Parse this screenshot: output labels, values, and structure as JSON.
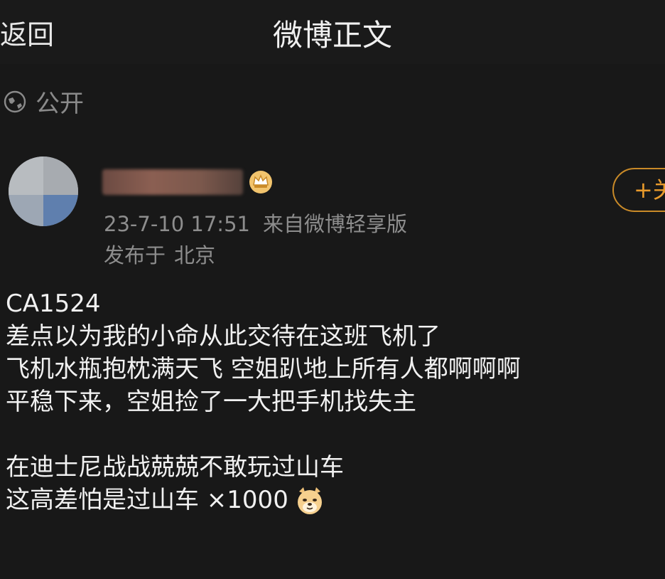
{
  "header": {
    "back_label": "返回",
    "title": "微博正文"
  },
  "post": {
    "visibility_label": "公开",
    "author": {
      "name_redacted": true,
      "badge_icon": "crown-badge-icon"
    },
    "follow_label": "+关",
    "timestamp": "23-7-10 17:51",
    "source": "来自微博轻享版",
    "location_prefix": "发布于",
    "location_city": "北京",
    "body_lines": [
      "CA1524",
      "差点以为我的小命从此交待在这班飞机了",
      "飞机水瓶抱枕满天飞  空姐趴地上所有人都啊啊啊",
      "平稳下来，空姐捡了一大把手机找失主",
      "",
      "在迪士尼战战兢兢不敢玩过山车",
      "这高差怕是过山车 ×1000"
    ],
    "emoji": "doge-emoji"
  },
  "colors": {
    "background": "#181818",
    "accent_follow": "#e89a2b",
    "meta_text": "#8d8d8d"
  }
}
